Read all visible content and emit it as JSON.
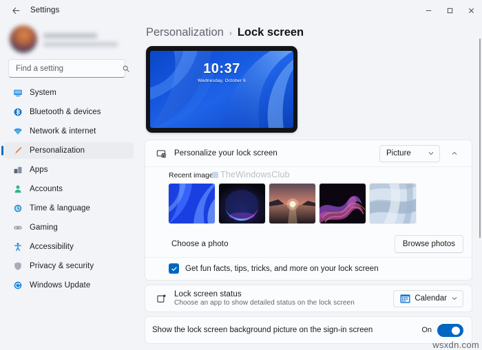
{
  "window": {
    "app_title": "Settings",
    "back_icon": "back-arrow-icon",
    "controls": {
      "minimize": "minimize-icon",
      "maximize": "maximize-icon",
      "close": "close-icon"
    }
  },
  "sidebar": {
    "account": {
      "name_hidden": "",
      "email_hidden": ""
    },
    "search": {
      "placeholder": "Find a setting",
      "value": "",
      "icon": "search-icon"
    },
    "items": [
      {
        "label": "System",
        "icon": "monitor-icon",
        "active": false
      },
      {
        "label": "Bluetooth & devices",
        "icon": "bluetooth-icon",
        "active": false
      },
      {
        "label": "Network & internet",
        "icon": "wifi-icon",
        "active": false
      },
      {
        "label": "Personalization",
        "icon": "paintbrush-icon",
        "active": true
      },
      {
        "label": "Apps",
        "icon": "apps-icon",
        "active": false
      },
      {
        "label": "Accounts",
        "icon": "person-icon",
        "active": false
      },
      {
        "label": "Time & language",
        "icon": "clock-icon",
        "active": false
      },
      {
        "label": "Gaming",
        "icon": "gamepad-icon",
        "active": false
      },
      {
        "label": "Accessibility",
        "icon": "accessibility-icon",
        "active": false
      },
      {
        "label": "Privacy & security",
        "icon": "shield-icon",
        "active": false
      },
      {
        "label": "Windows Update",
        "icon": "update-icon",
        "active": false
      }
    ]
  },
  "breadcrumb": {
    "parent": "Personalization",
    "separator": "›",
    "current": "Lock screen"
  },
  "preview": {
    "time": "10:37",
    "date": "Wednesday, October 6"
  },
  "personalize_row": {
    "title": "Personalize your lock screen",
    "icon": "lock-screen-icon",
    "dropdown_value": "Picture",
    "dropdown_icon": "chevron-down-icon",
    "expander_icon": "chevron-up-icon"
  },
  "recent_images": {
    "label": "Recent images",
    "thumbnails": [
      {
        "name": "blue-bloom-wallpaper"
      },
      {
        "name": "dark-glow-arc-wallpaper"
      },
      {
        "name": "sunset-lake-wallpaper"
      },
      {
        "name": "purple-swirl-wallpaper"
      },
      {
        "name": "light-blue-flow-wallpaper"
      }
    ]
  },
  "choose_photo_row": {
    "label": "Choose a photo",
    "button": "Browse photos"
  },
  "fun_facts_row": {
    "label": "Get fun facts, tips, tricks, and more on your lock screen",
    "checked": true
  },
  "status_row": {
    "title": "Lock screen status",
    "subtitle": "Choose an app to show detailed status on the lock screen",
    "icon": "status-tile-icon",
    "dropdown_value": "Calendar",
    "dropdown_app_icon": "calendar-icon",
    "dropdown_icon": "chevron-down-icon"
  },
  "signin_row": {
    "label": "Show the lock screen background picture on the sign-in screen",
    "state": "On",
    "enabled": true
  },
  "watermarks": {
    "overlay": "TheWindowsClub",
    "bottom": "wsxdn.com"
  },
  "colors": {
    "accent": "#0067c0",
    "selection_bar": "#0f6cbd",
    "window_bg": "#f2f4f8",
    "card_bg": "#fbfcfd"
  }
}
